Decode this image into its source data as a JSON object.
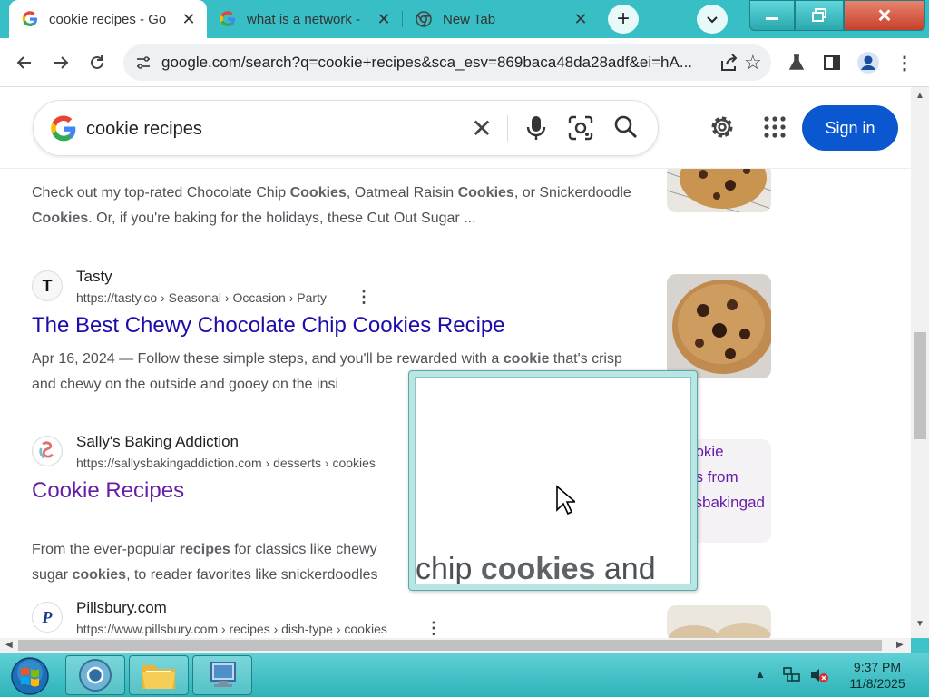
{
  "tabs": [
    {
      "title": "cookie recipes - Go",
      "active": true,
      "favicon": "google-g-icon"
    },
    {
      "title": "what is a network -",
      "active": false,
      "favicon": "google-g-icon"
    },
    {
      "title": "New Tab",
      "active": false,
      "favicon": "chrome-icon"
    }
  ],
  "toolbar": {
    "url": "google.com/search?q=cookie+recipes&sca_esv=869baca48da28adf&ei=hA..."
  },
  "search": {
    "query": "cookie recipes",
    "sign_in_label": "Sign in"
  },
  "results": [
    {
      "snippet_parts": [
        {
          "t": "Check out my top-rated Chocolate Chip ",
          "b": false
        },
        {
          "t": "Cookies",
          "b": true
        },
        {
          "t": ", Oatmeal Raisin ",
          "b": false
        },
        {
          "t": "Cookies",
          "b": true
        },
        {
          "t": ", or Snickerdoodle ",
          "b": false
        },
        {
          "t": "Cookies",
          "b": true
        },
        {
          "t": ". Or, if you're baking for the holidays, these Cut Out Sugar ...",
          "b": false
        }
      ]
    },
    {
      "site": "Tasty",
      "site_icon": "T",
      "url": "https://tasty.co › Seasonal › Occasion › Party",
      "title": "The Best Chewy Chocolate Chip Cookies Recipe",
      "snippet_parts": [
        {
          "t": "Apr 16, 2024 — Follow these simple steps, and you'll be rewarded with a ",
          "b": false
        },
        {
          "t": "cookie",
          "b": true
        },
        {
          "t": " that's crisp and chewy on the outside and gooey on the insi",
          "b": false
        }
      ]
    },
    {
      "site": "Sally's Baking Addiction",
      "url": "https://sallysbakingaddiction.com › desserts › cookies",
      "title": "Cookie Recipes",
      "side_text": "ookie\nes from\nysbakingad",
      "snippet_parts": [
        {
          "t": "From the ever-popular ",
          "b": false
        },
        {
          "t": "recipes",
          "b": true
        },
        {
          "t": " for classics like chewy",
          "b": false
        },
        {
          "t": "\n",
          "b": false
        },
        {
          "t": "sugar ",
          "b": false
        },
        {
          "t": "cookies",
          "b": true
        },
        {
          "t": ", to reader favorites like snickerdoodles",
          "b": false
        }
      ]
    },
    {
      "site": "Pillsbury.com",
      "site_icon": "P",
      "url": "https://www.pillsbury.com › recipes › dish-type › cookies"
    }
  ],
  "magnifier": {
    "text_parts": [
      {
        "t": "chip ",
        "b": false
      },
      {
        "t": "cookies",
        "b": true
      },
      {
        "t": " and",
        "b": false
      }
    ]
  },
  "taskbar": {
    "time": "9:37 PM",
    "date": "11/8/2025"
  },
  "colors": {
    "link": "#1a0dab",
    "visited": "#681da8",
    "accent": "#0b57d0",
    "window_frame": "#37bfc5"
  }
}
